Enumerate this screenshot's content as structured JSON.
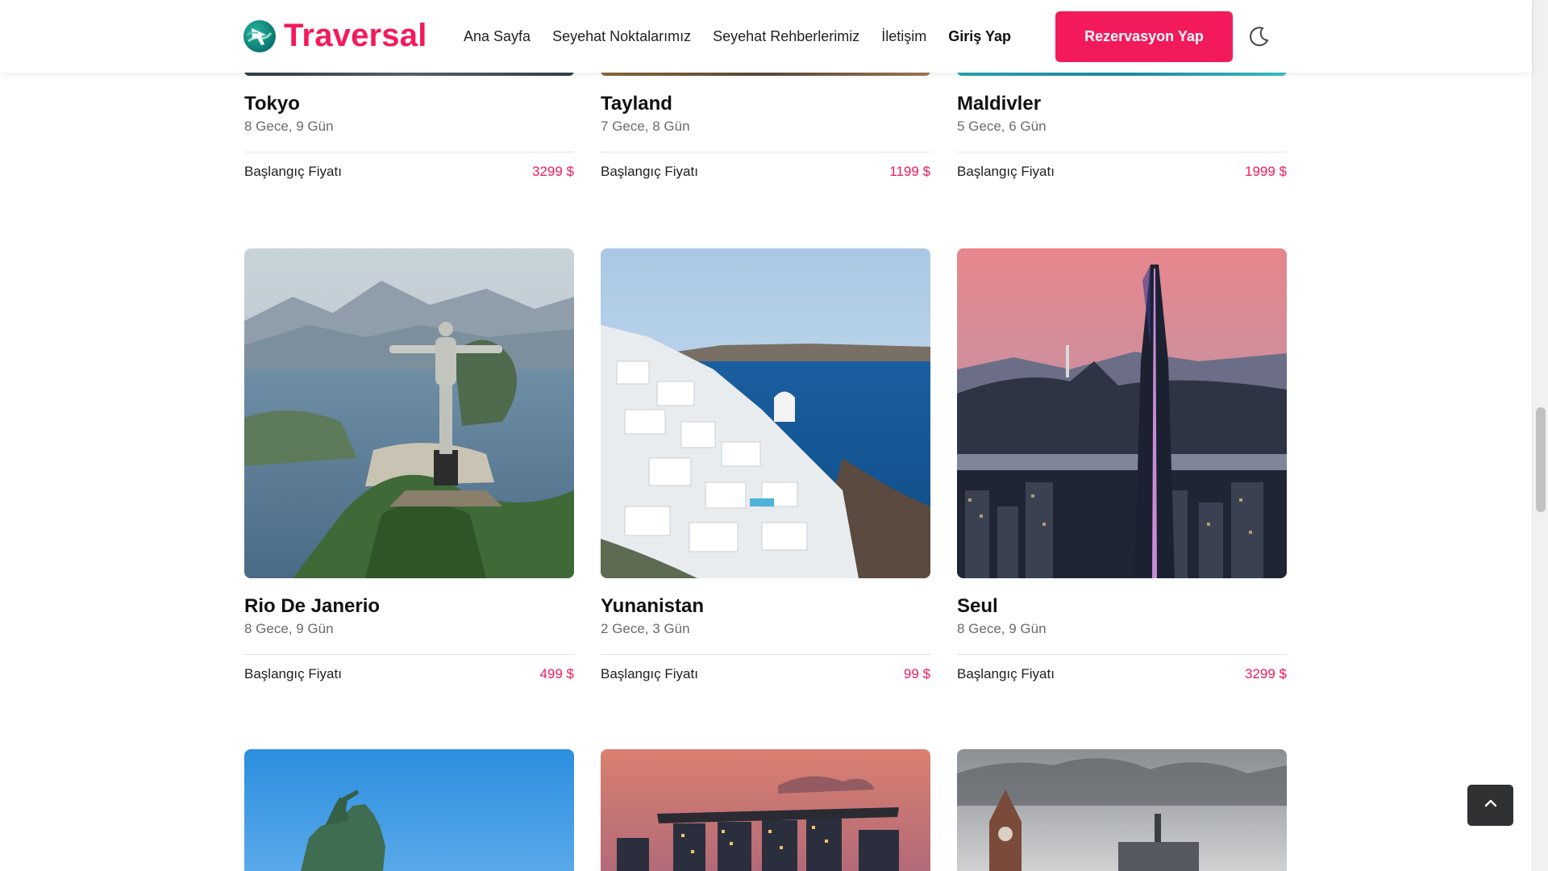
{
  "brand": {
    "name": "Traversal",
    "accent": "#f31a5c"
  },
  "nav": {
    "items": [
      "Ana Sayfa",
      "Seyehat Noktalarımız",
      "Seyehat Rehberlerimiz",
      "İletişim"
    ],
    "login": "Giriş Yap",
    "cta": "Rezervasyon Yap",
    "theme_icon": "moon-icon"
  },
  "price_label": "Başlangıç Fiyatı",
  "destinations_top": [
    {
      "title": "Tokyo",
      "duration": "8 Gece, 9 Gün",
      "price": "3299 $"
    },
    {
      "title": "Tayland",
      "duration": "7 Gece, 8 Gün",
      "price": "1199 $"
    },
    {
      "title": "Maldivler",
      "duration": "5 Gece, 6 Gün",
      "price": "1999 $"
    }
  ],
  "destinations_mid": [
    {
      "title": "Rio De Janerio",
      "duration": "8 Gece, 9 Gün",
      "price": "499 $",
      "image": "christ-the-redeemer-photo"
    },
    {
      "title": "Yunanistan",
      "duration": "2 Gece, 3 Gün",
      "price": "99 $",
      "image": "santorini-photo"
    },
    {
      "title": "Seul",
      "duration": "8 Gece, 9 Gün",
      "price": "3299 $",
      "image": "seoul-skyline-photo"
    }
  ],
  "destinations_bottom_images": [
    "equestrian-statue-photo",
    "marina-bay-sands-photo",
    "clock-tower-photo"
  ],
  "back_to_top_icon": "chevron-up-icon"
}
